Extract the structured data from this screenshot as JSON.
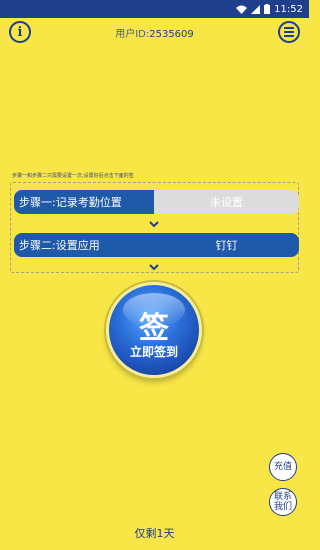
{
  "status_bar": {
    "time": "11:52"
  },
  "header": {
    "user_id_label": "用户ID:",
    "user_id_value": "2535609"
  },
  "hint": "步骤一和步骤二只需要设置一次,设置好后点击下面的签",
  "steps": [
    {
      "label": "步骤一:记录考勤位置",
      "value": "未设置"
    },
    {
      "label": "步骤二:设置应用",
      "value": "钉钉"
    }
  ],
  "sign_button": {
    "char": "签",
    "label": "立即签到"
  },
  "side_buttons": {
    "recharge": "充值",
    "contact_line1": "联系",
    "contact_line2": "我们"
  },
  "remaining": "仅剩1天",
  "colors": {
    "background": "#f7e645",
    "primary": "#1f5aaa",
    "status_bar": "#1f3f8c",
    "unset": "#dcdcdc"
  },
  "icons": {
    "info": "info-icon",
    "menu": "menu-icon",
    "wifi": "wifi-icon",
    "signal": "signal-icon",
    "battery": "battery-icon",
    "chevron": "chevron-down-icon"
  }
}
